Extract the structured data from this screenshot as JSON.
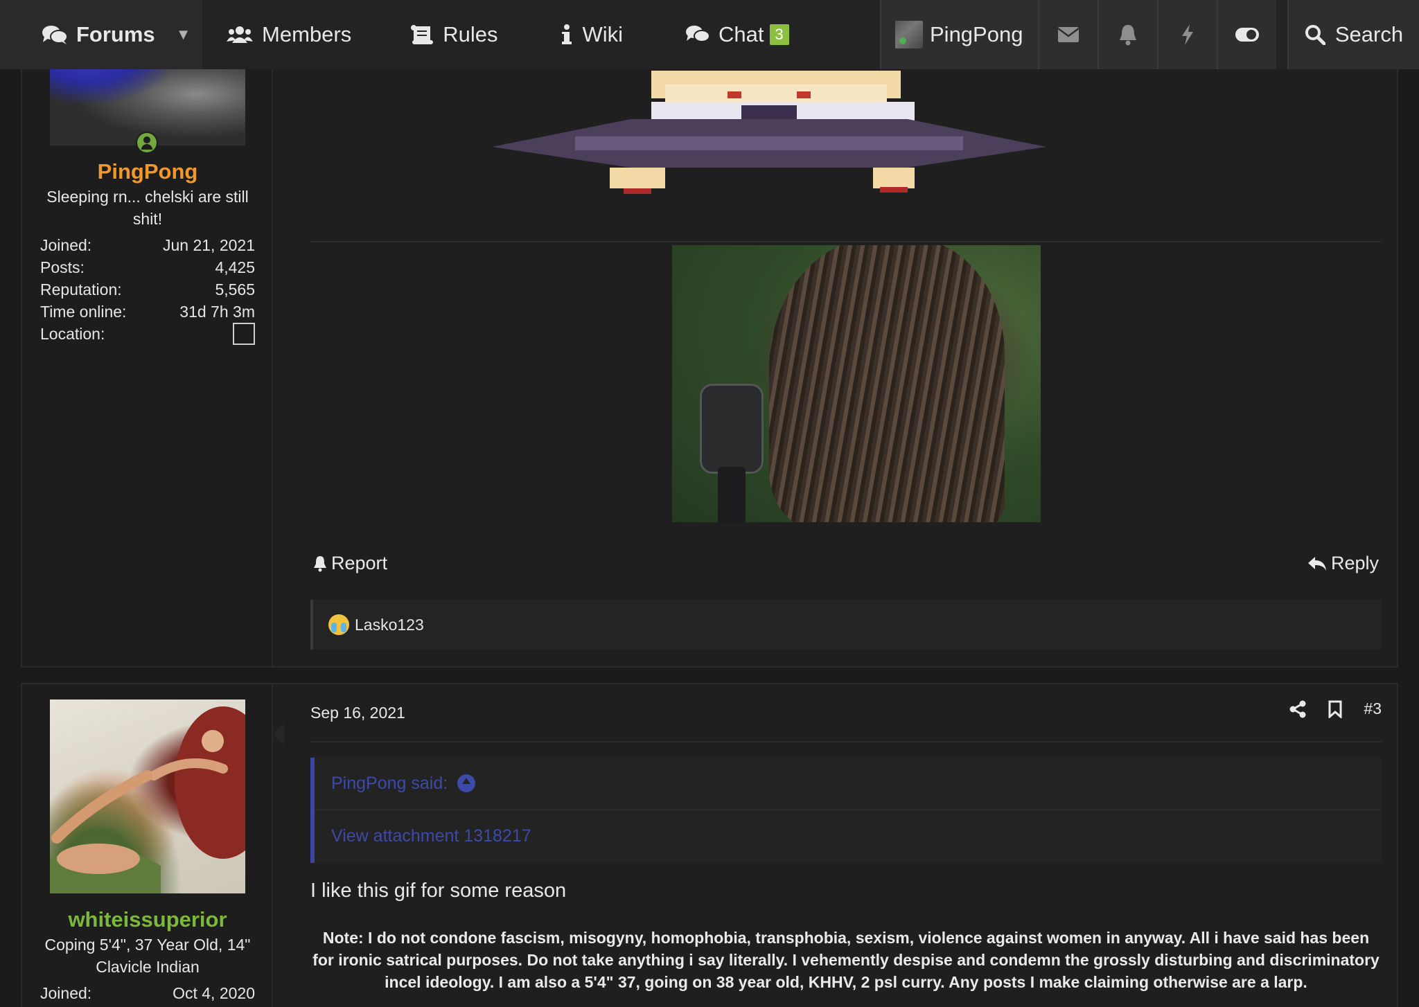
{
  "nav": {
    "forums": "Forums",
    "members": "Members",
    "rules": "Rules",
    "wiki": "Wiki",
    "chat": "Chat",
    "chat_badge": "3",
    "user": "PingPong",
    "search": "Search",
    "icons": [
      "envelope-icon",
      "bell-icon",
      "bolt-icon",
      "toggle-icon"
    ]
  },
  "post1": {
    "user": {
      "name": "PingPong",
      "name_color": "#f0982c",
      "title": "Sleeping rn... chelski are still shit!",
      "stats": [
        {
          "label": "Joined:",
          "value": "Jun 21, 2021"
        },
        {
          "label": "Posts:",
          "value": "4,425"
        },
        {
          "label": "Reputation:",
          "value": "5,565"
        },
        {
          "label": "Time online:",
          "value": "31d 7h 3m"
        },
        {
          "label": "Location:",
          "value": ""
        }
      ]
    },
    "report": "Report",
    "reply": "Reply",
    "reaction_user": "Lasko123"
  },
  "post2": {
    "user": {
      "name": "whiteissuperior",
      "name_color": "#7cb83c",
      "title": "Coping 5'4\", 37 Year Old, 14\" Clavicle Indian",
      "stats": [
        {
          "label": "Joined:",
          "value": "Oct 4, 2020"
        }
      ]
    },
    "date": "Sep 16, 2021",
    "post_number": "#3",
    "quote_author": "PingPong said:",
    "quote_body": "View attachment 1318217",
    "text": "I like this gif for some reason",
    "signature": "Note: I do not condone fascism, misogyny, homophobia, transphobia, sexism, violence against women in anyway. All i have said has been for ironic satrical purposes. Do not take anything i say literally. I vehemently despise and condemn the grossly disturbing and discriminatory incel ideology. I am also a 5'4\" 37, going on 38 year old, KHHV, 2 psl curry. Any posts I make claiming otherwise are a larp."
  }
}
